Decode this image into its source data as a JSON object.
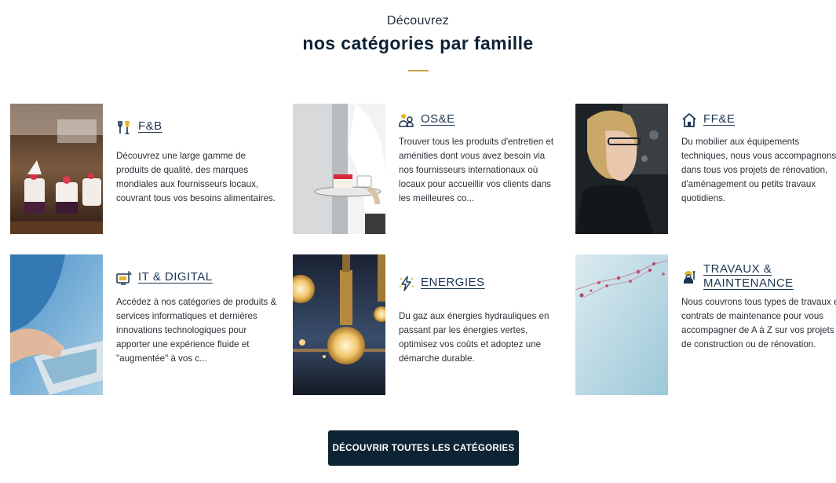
{
  "header": {
    "subtitle": "Découvrez",
    "title": "nos catégories par famille"
  },
  "categories": [
    {
      "title": "F&B",
      "icon": "fork-glass-icon",
      "description": "Découvrez une large gamme de produits de qualité, des marques mondiales aux fournisseurs locaux, couvrant tous vos besoins alimentaires."
    },
    {
      "title": "OS&E",
      "icon": "people-group-icon",
      "description": "Trouver tous les produits d'entretien et aménities dont vous avez besoin via nos fournisseurs internationaux où locaux pour accueillir vos clients dans les meilleures co..."
    },
    {
      "title": "FF&E",
      "icon": "house-icon",
      "description": "Du mobilier aux équipements techniques, nous vous accompagnons dans tous vos projets de rénovation, d'aménagement ou petits travaux quotidiens."
    },
    {
      "title": "IT & DIGITAL",
      "icon": "monitor-wifi-icon",
      "description": "Accédez à nos catégories de produits & services informatiques et dernières innovations technologiques pour apporter une expérience fluide et \"augmentée\" à vos c..."
    },
    {
      "title": "ENERGIES",
      "icon": "lightning-bolt-icon",
      "description": "Du gaz aux énergies hydrauliques en passant par les énergies vertes, optimisez vos coûts et adoptez une démarche durable."
    },
    {
      "title_line1": "TRAVAUX &",
      "title_line2": "MAINTENANCE",
      "icon": "worker-tools-icon",
      "description": "Nous couvrons tous types de travaux et contrats de maintenance pour vous accompagner de A à Z sur vos projets de construction ou de rénovation."
    }
  ],
  "cta": {
    "label": "DÉCOUVRIR TOUTES LES CATÉGORIES"
  },
  "colors": {
    "navy": "#0d2434",
    "gold_accent": "#c8a24a",
    "link": "#1a3550"
  }
}
